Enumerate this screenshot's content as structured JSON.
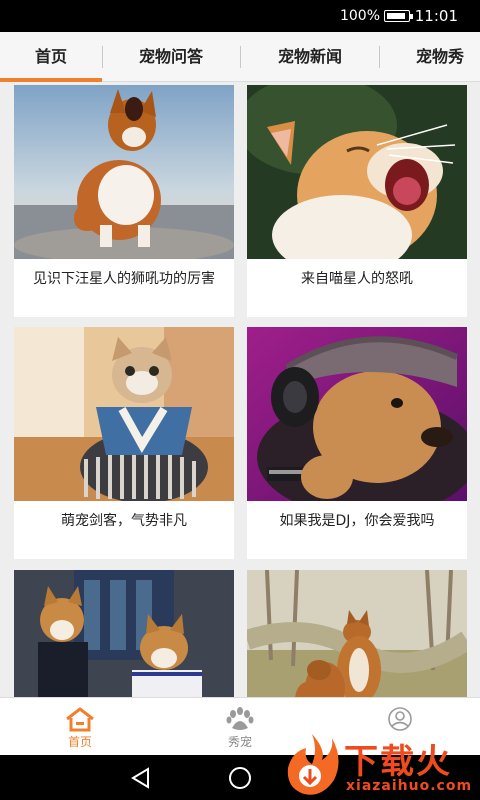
{
  "status_bar": {
    "battery_percent": "100%",
    "time": "11:01"
  },
  "tabs": [
    {
      "label": "首页",
      "active": true
    },
    {
      "label": "宠物问答",
      "active": false
    },
    {
      "label": "宠物新闻",
      "active": false
    },
    {
      "label": "宠物秀",
      "active": false
    }
  ],
  "cards": [
    {
      "caption": "见识下汪星人的狮吼功的厉害",
      "image": "corgi-barking-photo"
    },
    {
      "caption": "来自喵星人的怒吼",
      "image": "cat-yawning-photo"
    },
    {
      "caption": "萌宠剑客，气势非凡",
      "image": "cat-in-kimono-photo"
    },
    {
      "caption": "如果我是DJ，你会爱我吗",
      "image": "puppy-with-headphones-photo"
    },
    {
      "caption": "",
      "image": "shiba-dogs-in-costume-photo"
    },
    {
      "caption": "",
      "image": "dogs-playing-in-field-photo"
    }
  ],
  "bottom_nav": [
    {
      "label": "首页",
      "icon": "home-icon",
      "active": true
    },
    {
      "label": "秀宠",
      "icon": "paw-icon",
      "active": false
    },
    {
      "label": "",
      "icon": "user-icon",
      "active": false
    }
  ],
  "watermark": {
    "logo_text": "下载火",
    "url": "xiazaihuo.com"
  },
  "colors": {
    "accent": "#f0802c",
    "watermark": "#f04b1f"
  }
}
